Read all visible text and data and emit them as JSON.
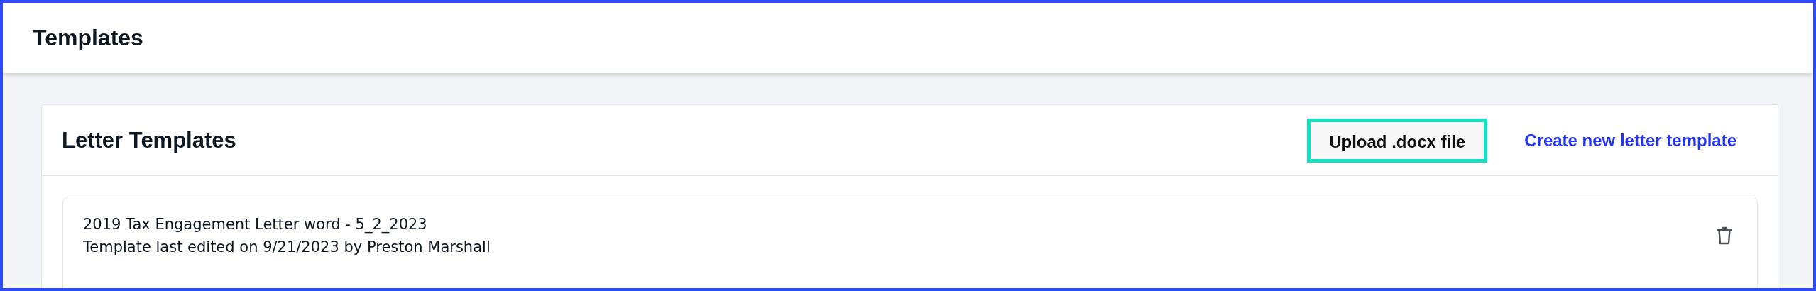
{
  "header": {
    "title": "Templates"
  },
  "card": {
    "title": "Letter Templates",
    "actions": [
      {
        "kind": "button",
        "label": "Upload .docx file",
        "highlighted": true
      },
      {
        "kind": "link",
        "label": "Create new letter template",
        "highlighted": false
      }
    ],
    "templates": [
      {
        "name": "2019 Tax Engagement Letter word - 5_2_2023",
        "meta": "Template last edited on 9/21/2023 by Preston Marshall"
      }
    ]
  }
}
